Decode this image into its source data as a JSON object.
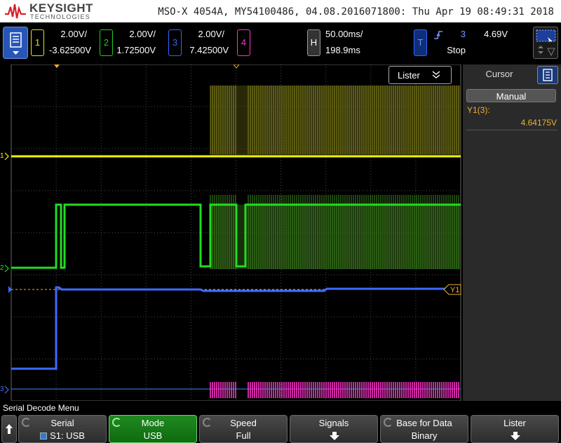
{
  "brand": {
    "name": "KEYSIGHT",
    "sub": "TECHNOLOGIES"
  },
  "header": {
    "info": "MSO-X 4054A, MY54100486, 04.08.2016071800: Thu Apr 19 08:49:31 2018"
  },
  "channels": [
    {
      "num": "1",
      "scale": "2.00V/",
      "offset": "-3.62500V",
      "color": "#e6e600"
    },
    {
      "num": "2",
      "scale": "2.00V/",
      "offset": "1.72500V",
      "color": "#22cc22"
    },
    {
      "num": "3",
      "scale": "2.00V/",
      "offset": "7.42500V",
      "color": "#3366ff"
    },
    {
      "num": "4",
      "color": "#ff33cc"
    }
  ],
  "horizontal": {
    "label": "H",
    "scale": "50.00ms/",
    "delay": "198.9ms"
  },
  "trigger": {
    "label": "T",
    "source": "3",
    "level": "4.69V",
    "state": "Stop",
    "edge_icon": "rising-edge-icon"
  },
  "lister": {
    "label": "Lister"
  },
  "side_panel": {
    "tab": "Cursor",
    "mode_button": "Manual",
    "y1_label": "Y1(3):",
    "y1_value": "4.64175V",
    "cursor_marker": "Y1"
  },
  "ground_markers": [
    "1",
    "2",
    "3"
  ],
  "menu_title": "Serial Decode Menu",
  "softkeys": [
    {
      "title": "Serial",
      "value": "S1: USB"
    },
    {
      "title": "Mode",
      "value": "USB",
      "active": true
    },
    {
      "title": "Speed",
      "value": "Full"
    },
    {
      "title": "Signals",
      "value": ""
    },
    {
      "title": "Base for Data",
      "value": "Binary"
    },
    {
      "title": "Lister",
      "value": ""
    }
  ]
}
